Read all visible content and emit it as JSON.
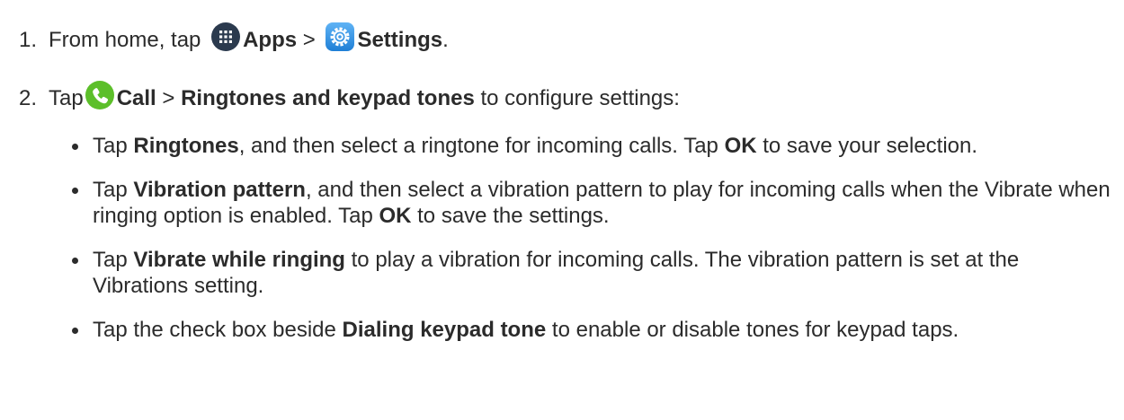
{
  "steps": [
    {
      "number": "1.",
      "text_before": "From home, tap",
      "icon1": "apps-icon",
      "label1": "Apps",
      "separator": ">",
      "icon2": "settings-icon",
      "label2": "Settings",
      "text_after": "."
    },
    {
      "number": "2.",
      "text_before": "Tap",
      "icon1": "phone-icon",
      "label1": "Call",
      "separator": ">",
      "label2": "Ringtones and keypad tones",
      "text_after": "to configure settings:"
    }
  ],
  "bullets": [
    {
      "pre": "Tap",
      "bold1": "Ringtones",
      "mid": ", and then select a ringtone for incoming calls. Tap",
      "bold2": "OK",
      "post": "to save your selection."
    },
    {
      "pre": "Tap",
      "bold1": "Vibration pattern",
      "mid": ", and then select a vibration pattern to play for incoming calls when the Vibrate when ringing option is enabled. Tap",
      "bold2": "OK",
      "post": "to save the settings."
    },
    {
      "pre": "Tap",
      "bold1": "Vibrate while ringing",
      "post": "to play a vibration for incoming calls. The vibration pattern is set at the Vibrations setting."
    },
    {
      "pre": "Tap the check box beside",
      "bold1": "Dialing keypad tone",
      "post": "to enable or disable tones for keypad taps."
    }
  ],
  "colors": {
    "text": "#2b2b2b",
    "apps_icon": "#2b3a4e",
    "settings_icon": "#2f8fe0",
    "phone_icon": "#5cbf2a"
  }
}
